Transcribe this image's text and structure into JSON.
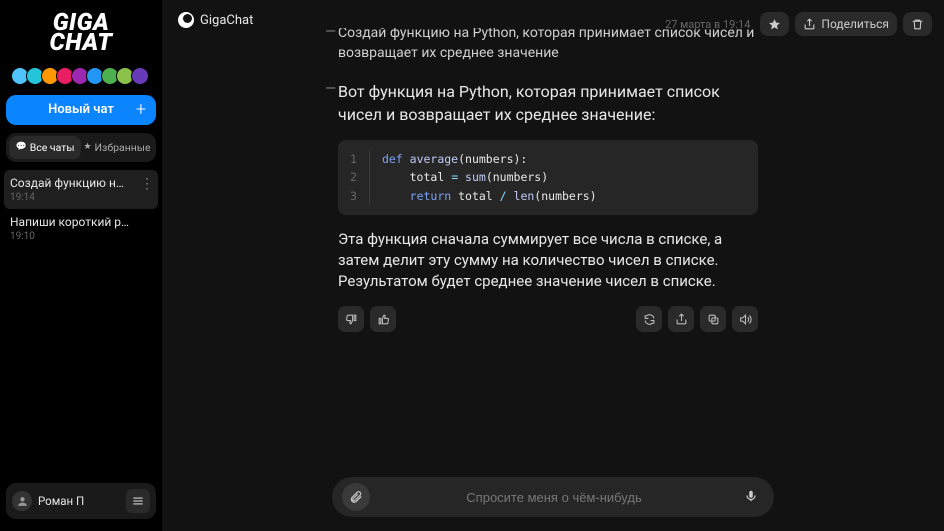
{
  "sidebar": {
    "logo_line1": "GIGA",
    "logo_line2": "CHAT",
    "avatar_colors": [
      "#4fc3f7",
      "#26c6da",
      "#ff9800",
      "#e91e63",
      "#9c27b0",
      "#2196f3",
      "#4caf50",
      "#8bc34a",
      "#673ab7"
    ],
    "new_chat_label": "Новый чат",
    "tabs": {
      "all_icon": "💬",
      "all_label": "Все чаты",
      "fav_icon": "★",
      "fav_label": "Избранные"
    },
    "chats": [
      {
        "title": "Создай функцию на Py...",
        "time": "19:14"
      },
      {
        "title": "Напиши короткий расс...",
        "time": "19:10"
      }
    ],
    "user": {
      "name": "Роман П"
    }
  },
  "header": {
    "brand": "GigaChat",
    "timestamp": "27 марта в 19:14",
    "share_label": "Поделиться"
  },
  "conversation": {
    "user_msg": "Создай функцию на Python, которая принимает список чисел и возвращает их среднее значение",
    "assistant_intro": "Вот функция на Python, которая принимает список чисел и возвращает их среднее значение:",
    "code": {
      "lines": [
        "1",
        "2",
        "3"
      ],
      "l1_kw": "def ",
      "l1_fn": "average",
      "l1_rest": "(numbers):",
      "l2_indent": "    total ",
      "l2_op": "=",
      "l2_sum": " sum",
      "l2_rest": "(numbers)",
      "l3_indent": "    ",
      "l3_ret": "return",
      "l3_mid": " total ",
      "l3_div": "/",
      "l3_len": " len",
      "l3_rest": "(numbers)"
    },
    "assistant_outro": "Эта функция сначала суммирует все числа в списке, а затем делит эту сумму на количество чисел в списке. Результатом будет среднее значение чисел в списке."
  },
  "input": {
    "placeholder": "Спросите меня о чём-нибудь"
  }
}
